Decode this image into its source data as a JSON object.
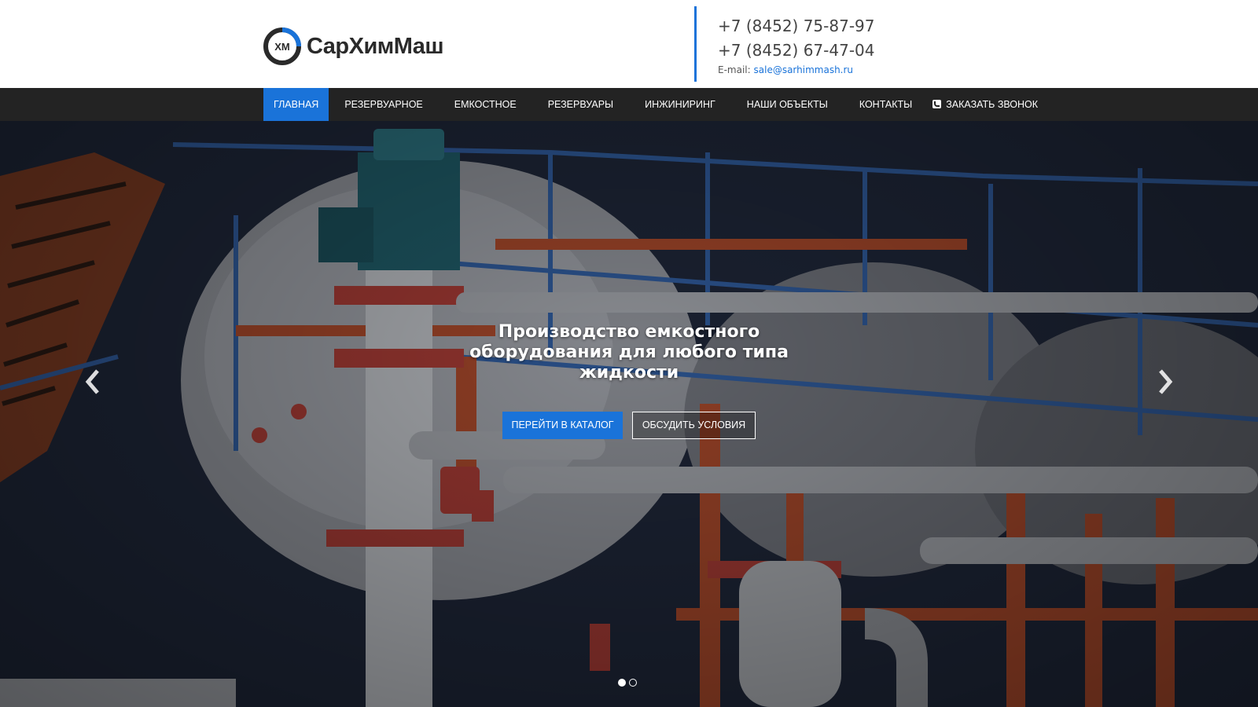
{
  "brand": {
    "name": "СарХимМаш",
    "mark_text": "ХМ"
  },
  "contacts": {
    "phone1": "+7 (8452) 75-87-97",
    "phone2": "+7 (8452) 67-47-04",
    "email_label": "E-mail:",
    "email": "sale@sarhimmash.ru"
  },
  "nav": {
    "items": [
      {
        "label": "Главная",
        "active": true
      },
      {
        "label": "Резервуарное"
      },
      {
        "label": "Емкостное"
      },
      {
        "label": "Резервуары"
      },
      {
        "label": "Инжиниринг"
      },
      {
        "label": "Наши объекты"
      },
      {
        "label": "Контакты"
      },
      {
        "label": "Заказать звонок",
        "icon": "phone-icon"
      }
    ]
  },
  "hero": {
    "title": "Производство емкостного оборудования для любого типа жидкости",
    "primary_button": "Перейти в каталог",
    "secondary_button": "Обсудить условия",
    "slides_total": 2,
    "active_slide": 1,
    "prev_icon": "chevron-left-icon",
    "next_icon": "chevron-right-icon"
  },
  "colors": {
    "accent": "#1a73d9",
    "nav_bg": "#232323",
    "text_dark": "#2a2a2a"
  }
}
